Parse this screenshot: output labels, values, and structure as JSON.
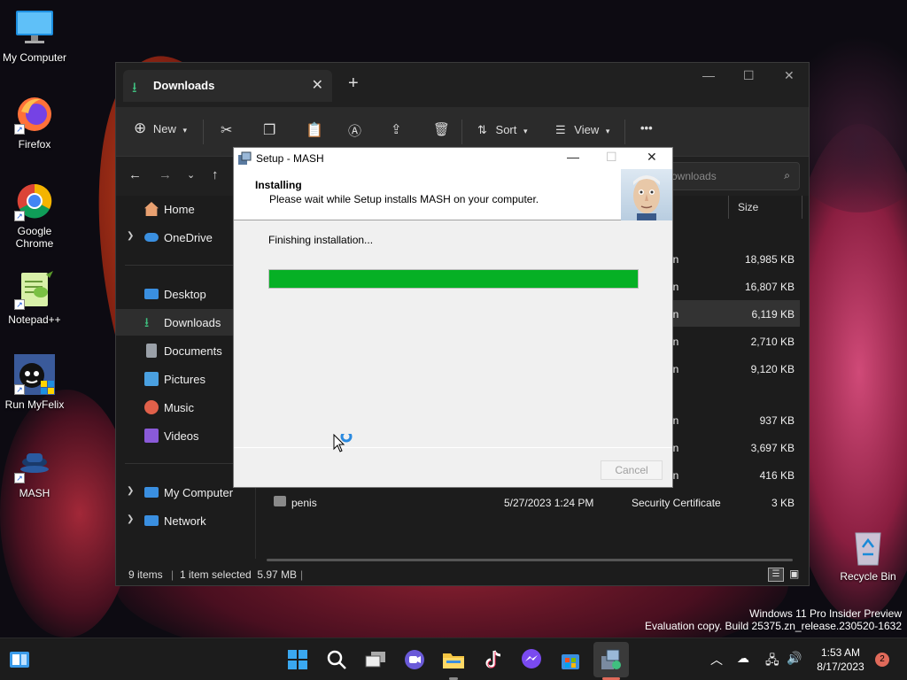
{
  "desktop": {
    "icons": [
      {
        "label": "My Computer",
        "icon": "monitor-icon"
      },
      {
        "label": "Firefox",
        "icon": "firefox-icon"
      },
      {
        "label": "Google Chrome",
        "icon": "chrome-icon"
      },
      {
        "label": "Notepad++",
        "icon": "notepadpp-icon"
      },
      {
        "label": "Run MyFelix",
        "icon": "myfelix-icon"
      },
      {
        "label": "MASH",
        "icon": "mash-icon"
      }
    ],
    "recycle_bin": "Recycle Bin"
  },
  "explorer": {
    "tab_label": "Downloads",
    "toolbar": {
      "new_label": "New",
      "sort_label": "Sort",
      "view_label": "View",
      "more_label": "•••"
    },
    "search_placeholder": "ownloads",
    "columns": {
      "size": "Size"
    },
    "sidebar": [
      {
        "label": "Home",
        "icon": "home-icon",
        "color": "#e8a070"
      },
      {
        "label": "OneDrive",
        "icon": "cloud-icon",
        "color": "#3a8fe0"
      },
      {
        "label": "Desktop",
        "icon": "desktop-icon",
        "color": "#3a8fe0"
      },
      {
        "label": "Downloads",
        "icon": "download-icon",
        "color": "#3fbf7f"
      },
      {
        "label": "Documents",
        "icon": "document-icon",
        "color": "#9aa0a8"
      },
      {
        "label": "Pictures",
        "icon": "pictures-icon",
        "color": "#4aa0e0"
      },
      {
        "label": "Music",
        "icon": "music-icon",
        "color": "#e0604a"
      },
      {
        "label": "Videos",
        "icon": "videos-icon",
        "color": "#8a5ad8"
      },
      {
        "label": "My Computer",
        "icon": "computer-icon",
        "color": "#3a8fe0"
      },
      {
        "label": "Network",
        "icon": "network-icon",
        "color": "#3a8fe0"
      }
    ],
    "files": [
      {
        "name": "",
        "date": "",
        "type": "on",
        "size": "18,985 KB"
      },
      {
        "name": "",
        "date": "",
        "type": "on",
        "size": "16,807 KB"
      },
      {
        "name": "",
        "date": "",
        "type": "on",
        "size": "6,119 KB"
      },
      {
        "name": "",
        "date": "",
        "type": "on",
        "size": "2,710 KB"
      },
      {
        "name": "",
        "date": "",
        "type": "on",
        "size": "9,120 KB"
      },
      {
        "name": "",
        "date": "",
        "type": "on",
        "size": "937 KB"
      },
      {
        "name": "",
        "date": "",
        "type": "on",
        "size": "3,697 KB"
      },
      {
        "name": "",
        "date": "",
        "type": "on",
        "size": "416 KB"
      },
      {
        "name": "penis",
        "date": "5/27/2023 1:24 PM",
        "type": "Security Certificate",
        "size": "3 KB"
      }
    ],
    "status": {
      "items": "9 items",
      "selected": "1 item selected  5.97 MB"
    }
  },
  "setup": {
    "title": "Setup - MASH",
    "heading": "Installing",
    "subheading": "Please wait while Setup installs MASH on your computer.",
    "status_text": "Finishing installation...",
    "progress": 1.0,
    "cancel_label": "Cancel"
  },
  "watermark": {
    "line1": "Windows 11 Pro Insider Preview",
    "line2": "Evaluation copy. Build 25375.zn_release.230520-1632"
  },
  "taskbar": {
    "time": "1:53 AM",
    "date": "8/17/2023",
    "notification_count": "2"
  }
}
